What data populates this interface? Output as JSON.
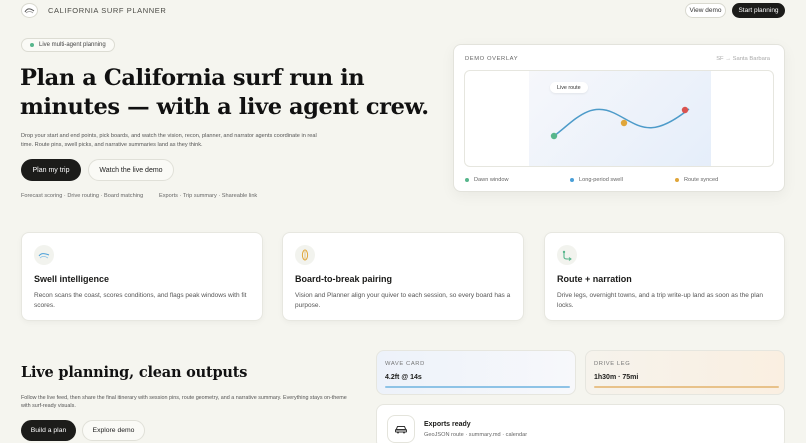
{
  "header": {
    "brand_name": "CALIFORNIA SURF PLANNER",
    "view_demo": "View demo",
    "start_planning": "Start planning"
  },
  "hero": {
    "badge": "Live multi-agent planning",
    "title": "Plan a California surf run in minutes — with a live agent crew.",
    "description": "Drop your start and end points, pick boards, and watch the vision, recon, planner, and narrator agents coordinate in real time. Route pins, swell picks, and narrative summaries land as they think.",
    "primary_cta": "Plan my trip",
    "secondary_cta": "Watch the live demo",
    "meta_left": "Forecast scoring · Drive routing · Board matching",
    "meta_right": "Exports · Trip summary · Shareable link"
  },
  "demo": {
    "label": "DEMO OVERLAY",
    "route": "SF → Santa Barbara",
    "route_tag": "Live route",
    "legend": [
      {
        "label": "Dawn window",
        "color": "#57b68c"
      },
      {
        "label": "Long-period swell",
        "color": "#4a9fd8"
      },
      {
        "label": "Route synced",
        "color": "#e0a63a"
      }
    ],
    "colors": {
      "line": "#4d9bc9",
      "start": "#57b68c",
      "mid": "#e0a63a",
      "end": "#d9534f"
    }
  },
  "features": [
    {
      "title": "Swell intelligence",
      "description": "Recon scans the coast, scores conditions, and flags peak windows with fit scores.",
      "icon": "wave-icon"
    },
    {
      "title": "Board-to-break pairing",
      "description": "Vision and Planner align your quiver to each session, so every board has a purpose.",
      "icon": "surfboard-icon"
    },
    {
      "title": "Route + narration",
      "description": "Drive legs, overnight towns, and a trip write-up land as soon as the plan locks.",
      "icon": "route-icon"
    }
  ],
  "bottom": {
    "title": "Live planning, clean outputs",
    "description": "Follow the live feed, then share the final itinerary with session pins, route geometry, and a narrative summary. Everything stays on-theme with surf-ready visuals.",
    "primary_cta": "Build a plan",
    "secondary_cta": "Explore demo"
  },
  "stats": {
    "wave": {
      "label": "WAVE CARD",
      "value": "4.2ft @ 14s",
      "bar_color": "#8ec3e6"
    },
    "drive": {
      "label": "DRIVE LEG",
      "value": "1h30m · 75mi",
      "bar_color": "#e8c28a"
    }
  },
  "exports": {
    "title": "Exports ready",
    "subtitle": "GeoJSON route · summary.md · calendar",
    "icon": "car-icon"
  }
}
